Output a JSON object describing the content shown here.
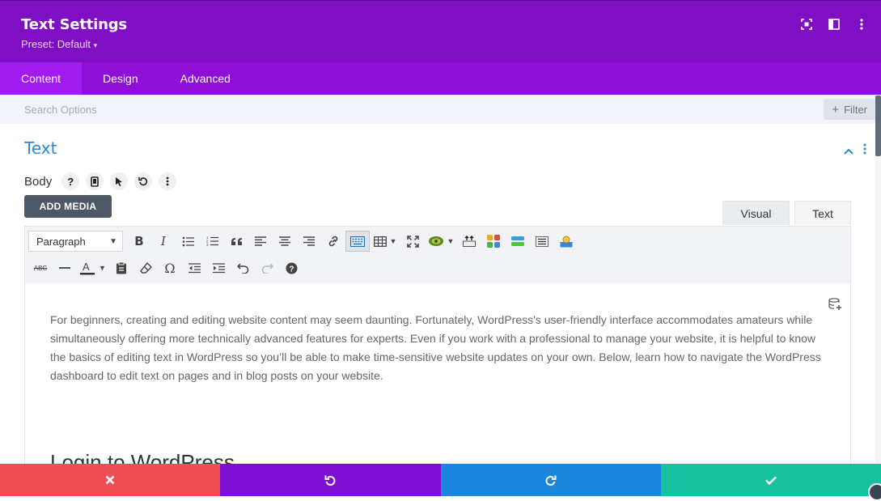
{
  "header": {
    "title": "Text Settings",
    "preset": "Preset: Default",
    "icons": [
      "expand-icon",
      "split-view-icon",
      "more-vertical-icon"
    ]
  },
  "tabs": [
    {
      "label": "Content",
      "active": true
    },
    {
      "label": "Design",
      "active": false
    },
    {
      "label": "Advanced",
      "active": false
    }
  ],
  "search": {
    "placeholder": "Search Options",
    "filter_label": "Filter"
  },
  "section": {
    "title": "Text"
  },
  "body_field": {
    "label": "Body"
  },
  "add_media_label": "ADD MEDIA",
  "editor_tabs": {
    "visual": "Visual",
    "text": "Text"
  },
  "toolbar": {
    "format_select": "Paragraph"
  },
  "content": {
    "paragraph": "For beginners, creating and editing website content may seem daunting. Fortunately, WordPress's user-friendly interface accommodates amateurs while simultaneously offering more technically advanced features for experts. Even if you work with a professional to manage your website, it is helpful to know the basics of editing text in WordPress so you’ll be able to make time-sensitive website updates on your own. Below, learn how to navigate the WordPress dashboard to edit text on pages and in blog posts on your website.",
    "heading": "Login to WordPress"
  },
  "colors": {
    "header": "#7e0fc2",
    "tabs": "#8f0fd6",
    "accent_blue": "#2b87da",
    "cancel": "#ef4e56",
    "undo": "#7e0fd2",
    "redo": "#1b86db",
    "save": "#18c1a0"
  }
}
